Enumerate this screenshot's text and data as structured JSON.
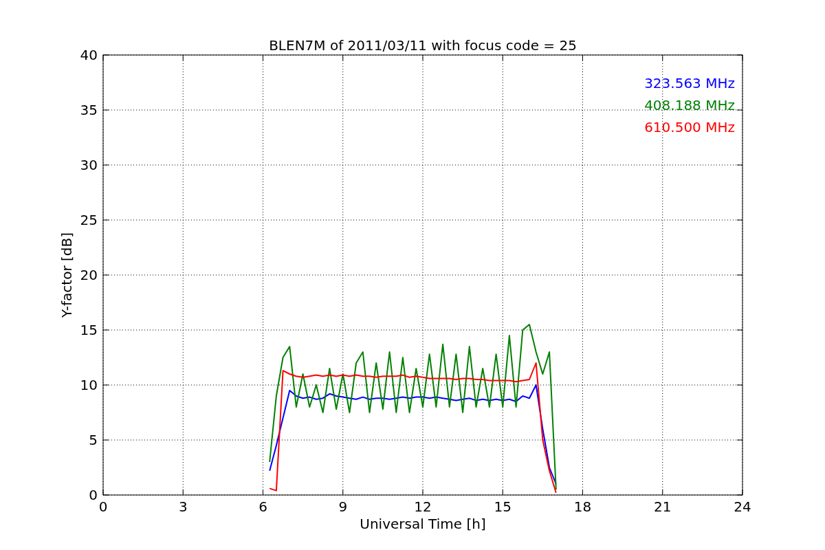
{
  "chart_data": {
    "type": "line",
    "title": "BLEN7M of 2011/03/11 with focus code = 25",
    "xlabel": "Universal Time [h]",
    "ylabel": "Y-factor [dB]",
    "x": [
      6.25,
      6.5,
      6.75,
      7.0,
      7.25,
      7.5,
      7.75,
      8.0,
      8.25,
      8.5,
      8.75,
      9.0,
      9.25,
      9.5,
      9.75,
      10.0,
      10.25,
      10.5,
      10.75,
      11.0,
      11.25,
      11.5,
      11.75,
      12.0,
      12.25,
      12.5,
      12.75,
      13.0,
      13.25,
      13.5,
      13.75,
      14.0,
      14.25,
      14.5,
      14.75,
      15.0,
      15.25,
      15.5,
      15.75,
      16.0,
      16.25,
      16.5,
      16.75,
      17.0
    ],
    "series": [
      {
        "name": "323.563 MHz",
        "color": "#0000ff",
        "values": [
          2.2,
          4.5,
          7.0,
          9.5,
          9.0,
          8.8,
          8.9,
          8.7,
          8.8,
          9.2,
          9.0,
          8.9,
          8.8,
          8.7,
          8.9,
          8.7,
          8.8,
          8.8,
          8.7,
          8.8,
          8.9,
          8.8,
          8.9,
          8.9,
          8.8,
          8.9,
          8.8,
          8.7,
          8.6,
          8.7,
          8.8,
          8.6,
          8.7,
          8.6,
          8.7,
          8.6,
          8.7,
          8.5,
          9.0,
          8.8,
          10.0,
          6.0,
          2.5,
          1.0
        ]
      },
      {
        "name": "408.188 MHz",
        "color": "#008000",
        "values": [
          3.0,
          9.0,
          12.5,
          13.5,
          8.0,
          11.0,
          8.0,
          10.0,
          7.5,
          11.5,
          7.8,
          11.0,
          7.5,
          12.0,
          13.0,
          7.5,
          12.0,
          7.8,
          13.0,
          7.5,
          12.5,
          7.5,
          11.5,
          8.0,
          12.8,
          8.0,
          13.7,
          8.0,
          12.8,
          7.5,
          13.5,
          8.0,
          11.5,
          8.0,
          12.8,
          8.0,
          14.5,
          8.0,
          15.0,
          15.5,
          13.0,
          11.0,
          13.0,
          0.5
        ]
      },
      {
        "name": "610.500 MHz",
        "color": "#ff0000",
        "values": [
          0.6,
          0.4,
          11.3,
          11.0,
          10.8,
          10.7,
          10.8,
          10.9,
          10.8,
          10.9,
          10.8,
          10.9,
          10.8,
          10.9,
          10.8,
          10.8,
          10.7,
          10.8,
          10.8,
          10.8,
          10.9,
          10.7,
          10.8,
          10.7,
          10.6,
          10.6,
          10.6,
          10.6,
          10.5,
          10.6,
          10.6,
          10.5,
          10.5,
          10.4,
          10.4,
          10.4,
          10.4,
          10.3,
          10.4,
          10.5,
          12.0,
          5.0,
          2.2,
          0.2
        ]
      }
    ],
    "grid": true,
    "xlim": [
      0,
      24
    ],
    "ylim": [
      0,
      40
    ],
    "xticks": [
      0,
      3,
      6,
      9,
      12,
      15,
      18,
      21,
      24
    ],
    "yticks": [
      0,
      5,
      10,
      15,
      20,
      25,
      30,
      35,
      40
    ]
  }
}
